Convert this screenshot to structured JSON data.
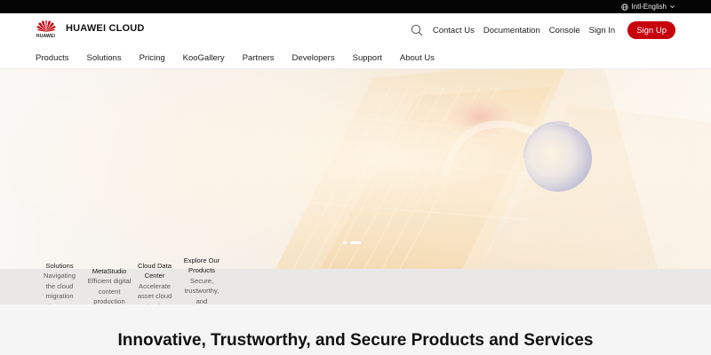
{
  "topbar": {
    "language": "Intl-English"
  },
  "header": {
    "logo_word": "HUAWEI",
    "brand": "HUAWEI CLOUD",
    "links": [
      "Contact Us",
      "Documentation",
      "Console",
      "Sign In"
    ],
    "signup": "Sign Up",
    "accent_color": "#c7000b"
  },
  "nav": {
    "items": [
      "Products",
      "Solutions",
      "Pricing",
      "KooGallery",
      "Partners",
      "Developers",
      "Support",
      "About Us"
    ]
  },
  "hero": {
    "carousel_slides": 2,
    "active_slide": 2
  },
  "quick_links": [
    {
      "title": "Solutions",
      "desc": "Navigating the cloud migration journey"
    },
    {
      "title": "MetaStudio",
      "desc": "Efficient digital content production"
    },
    {
      "title": "Cloud Data Center",
      "desc": "Accelerate asset cloud adoption"
    },
    {
      "title": "Explore Our Products",
      "desc": "Secure, trustworthy, and innovative"
    }
  ],
  "section": {
    "title": "Innovative, Trustworthy, and Secure Products and Services"
  }
}
